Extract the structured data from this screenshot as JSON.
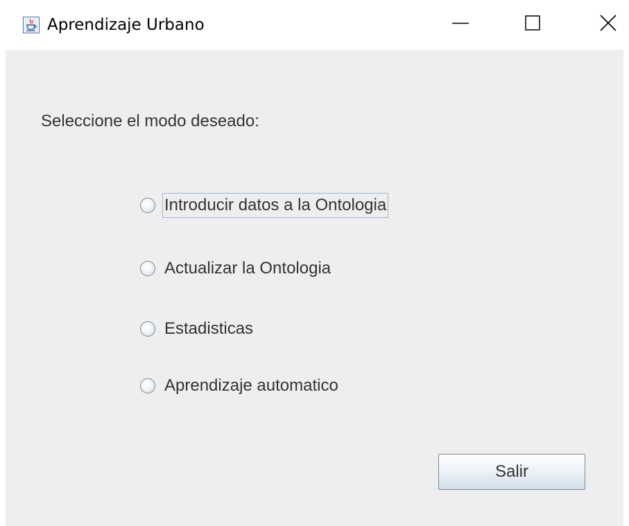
{
  "window": {
    "title": "Aprendizaje Urbano",
    "app_icon": "java-cup-icon",
    "controls": {
      "minimize_icon": "minimize-icon",
      "maximize_icon": "maximize-icon",
      "close_icon": "close-icon"
    }
  },
  "main": {
    "prompt": "Seleccione el modo deseado:",
    "options": [
      {
        "label": "Introducir datos a la Ontologia",
        "selected": false,
        "focused": true
      },
      {
        "label": "Actualizar la Ontologia",
        "selected": false,
        "focused": false
      },
      {
        "label": "Estadisticas",
        "selected": false,
        "focused": false
      },
      {
        "label": "Aprendizaje automatico",
        "selected": false,
        "focused": false
      }
    ],
    "exit_button_label": "Salir"
  },
  "colors": {
    "panel_background": "#eeeeee",
    "text": "#333333",
    "focus_border": "#a3b8cc",
    "button_border": "#7a8a99"
  }
}
